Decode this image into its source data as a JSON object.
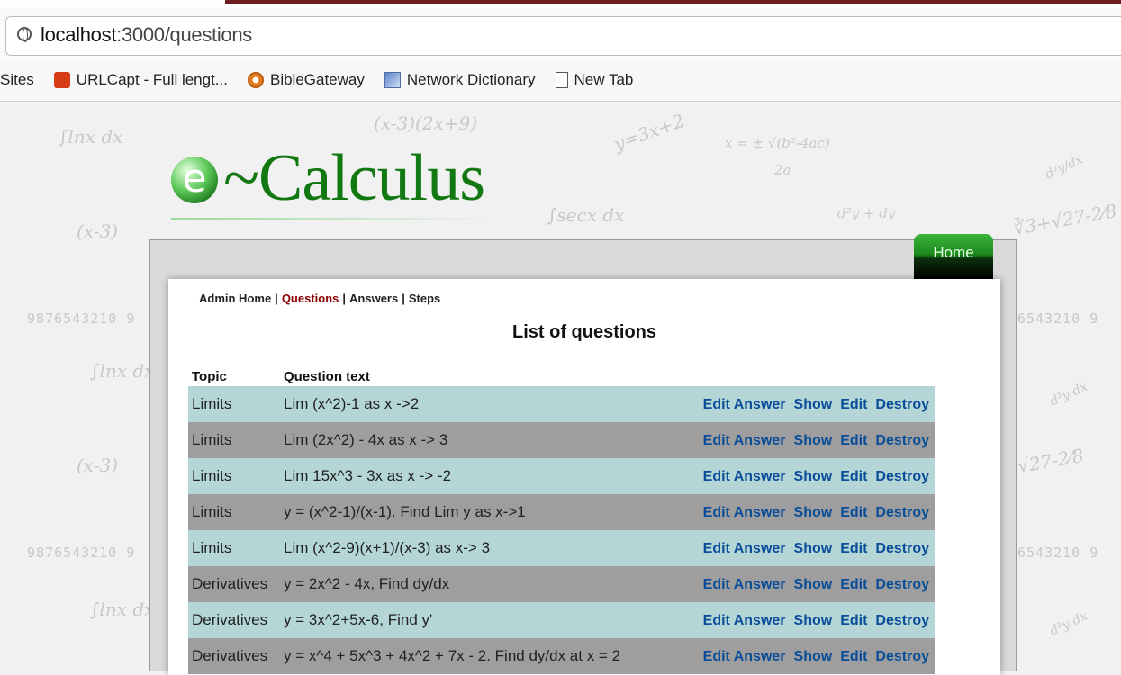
{
  "browser": {
    "url_host": "localhost",
    "url_rest": ":3000/questions",
    "bookmarks": [
      "Sites",
      "URLCapt - Full lengt...",
      "BibleGateway",
      "Network Dictionary",
      "New Tab"
    ]
  },
  "logo": {
    "text": "~Calculus",
    "letter": "e"
  },
  "nav": {
    "home_tab": "Home",
    "admin_home": "Admin Home",
    "questions": "Questions",
    "answers": "Answers",
    "steps": "Steps",
    "separator": "|"
  },
  "page": {
    "title": "List of questions",
    "columns": [
      "Topic",
      "Question text"
    ],
    "actions": [
      "Edit Answer",
      "Show",
      "Edit",
      "Destroy"
    ]
  },
  "questions": [
    {
      "topic": "Limits",
      "text": "Lim (x^2)-1 as x ->2"
    },
    {
      "topic": "Limits",
      "text": "Lim (2x^2) - 4x as x -> 3"
    },
    {
      "topic": "Limits",
      "text": "Lim 15x^3 - 3x as x -> -2"
    },
    {
      "topic": "Limits",
      "text": "y = (x^2-1)/(x-1). Find Lim y as x->1"
    },
    {
      "topic": "Limits",
      "text": "Lim (x^2-9)(x+1)/(x-3) as x-> 3"
    },
    {
      "topic": "Derivatives",
      "text": "y = 2x^2 - 4x, Find dy/dx"
    },
    {
      "topic": "Derivatives",
      "text": "y = 3x^2+5x-6, Find y'"
    },
    {
      "topic": "Derivatives",
      "text": "y = x^4 + 5x^3 + 4x^2 + 7x - 2. Find dy/dx at x = 2"
    }
  ],
  "colors": {
    "row_light": "#b4d6d6",
    "row_dark": "#9e9e9e",
    "logo_green": "#127812",
    "link": "#0a4e9a"
  }
}
